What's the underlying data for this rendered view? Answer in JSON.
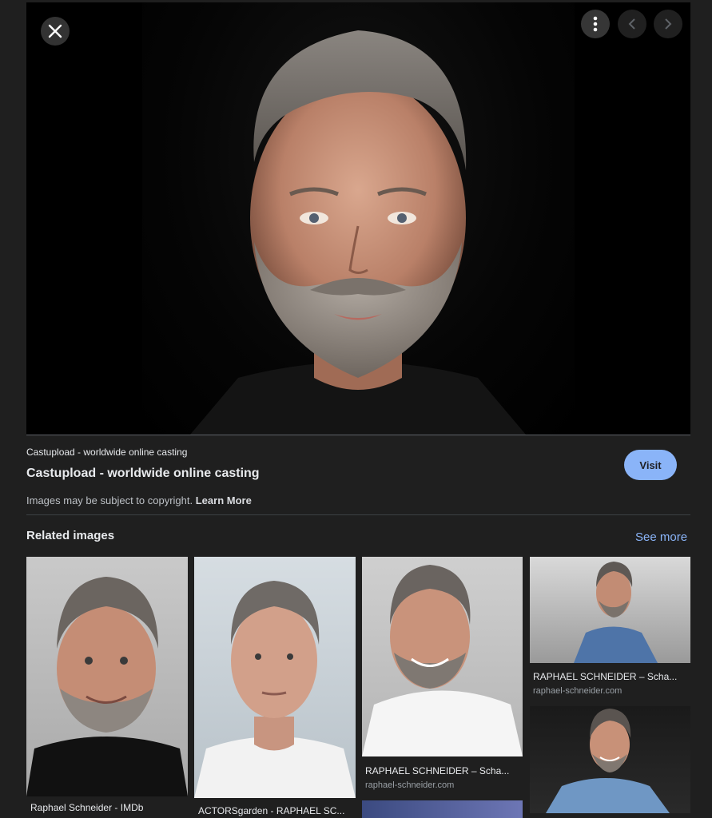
{
  "hero": {
    "image_alt": "Portrait of a man with grey hair and beard on black background"
  },
  "controls": {
    "close_icon": "close-icon",
    "more_icon": "more-vert-icon",
    "prev_icon": "chevron-left-icon",
    "next_icon": "chevron-right-icon"
  },
  "source": {
    "site_name": "Castupload - worldwide online casting",
    "page_title": "Castupload - worldwide online casting",
    "visit_label": "Visit",
    "copyright_text": "Images may be subject to copyright.",
    "learn_more_label": "Learn More"
  },
  "related": {
    "title": "Related images",
    "see_more_label": "See more",
    "items": [
      {
        "caption": "Raphael Schneider - IMDb",
        "domain": ""
      },
      {
        "caption": "ACTORSgarden - RAPHAEL SC...",
        "domain": ""
      },
      {
        "caption": "RAPHAEL SCHNEIDER – Scha...",
        "domain": "raphael-schneider.com"
      },
      {
        "caption": "RAPHAEL SCHNEIDER – Scha...",
        "domain": "raphael-schneider.com"
      }
    ]
  },
  "colors": {
    "background": "#1f1f1f",
    "accent": "#8ab4f8",
    "visit_button_bg": "#8ab4f8"
  }
}
